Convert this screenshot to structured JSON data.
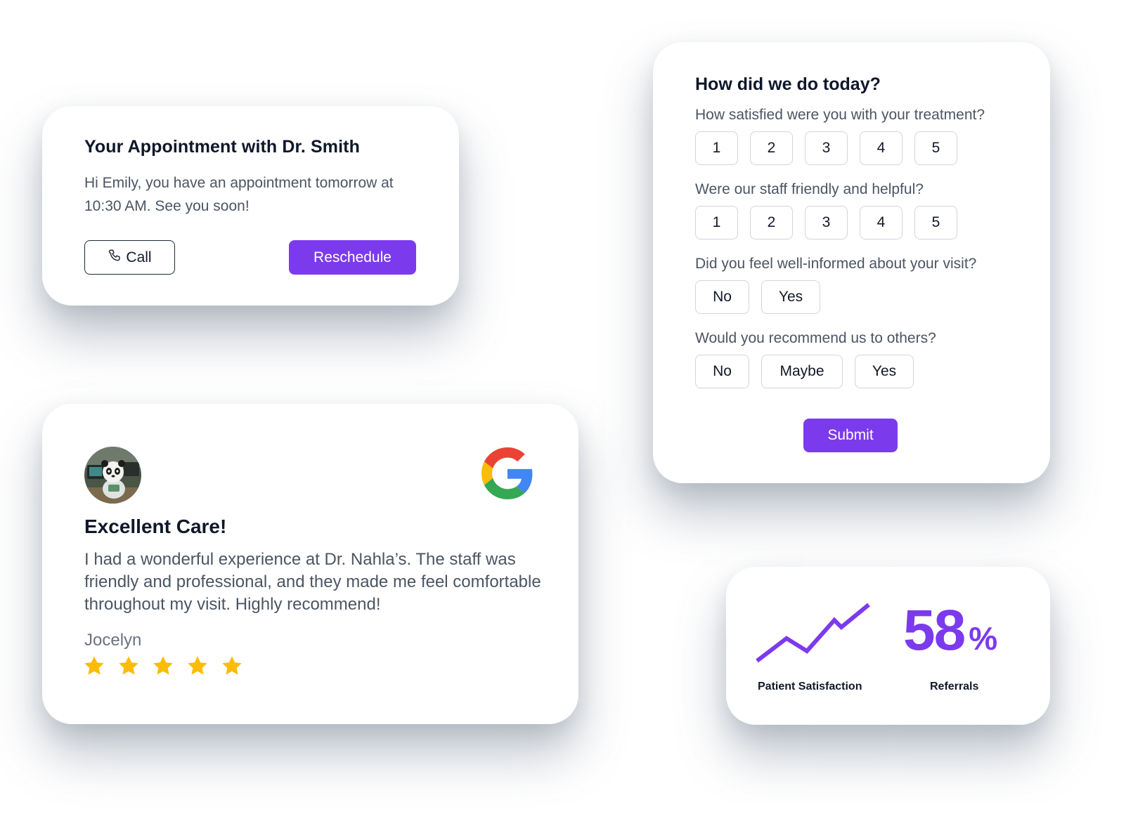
{
  "appointment": {
    "title": "Your Appointment with Dr. Smith",
    "message": "Hi Emily, you have an appointment tomorrow at 10:30 AM. See you soon!",
    "call_label": "Call",
    "reschedule_label": "Reschedule",
    "call_icon": "phone-icon"
  },
  "survey": {
    "title": "How did we do today?",
    "questions": [
      {
        "text": "How satisfied were you with your treatment?",
        "options": [
          "1",
          "2",
          "3",
          "4",
          "5"
        ]
      },
      {
        "text": "Were our staff friendly and helpful?",
        "options": [
          "1",
          "2",
          "3",
          "4",
          "5"
        ]
      },
      {
        "text": "Did you feel well-informed about your visit?",
        "options": [
          "No",
          "Yes"
        ]
      },
      {
        "text": "Would you recommend us to others?",
        "options": [
          "No",
          "Maybe",
          "Yes"
        ]
      }
    ],
    "submit_label": "Submit"
  },
  "review": {
    "title": "Excellent Care!",
    "body": "I had a wonderful experience at Dr. Nahla’s. The staff was friendly and professional, and they made me feel comfortable throughout my visit. Highly recommend!",
    "author": "Jocelyn",
    "rating": 5,
    "max_rating": 5,
    "source_icon": "google-logo-icon",
    "avatar_icon": "panda-avatar"
  },
  "stats": {
    "trend_label": "Patient Satisfaction",
    "trend_icon": "trend-up-line-icon",
    "percent_value": "58",
    "percent_symbol": "%",
    "percent_label": "Referrals"
  },
  "colors": {
    "accent": "#7c3aed",
    "star": "#fbbc05",
    "heading": "#0f172a",
    "body_text": "#4b5563",
    "border": "#d1d5db"
  }
}
